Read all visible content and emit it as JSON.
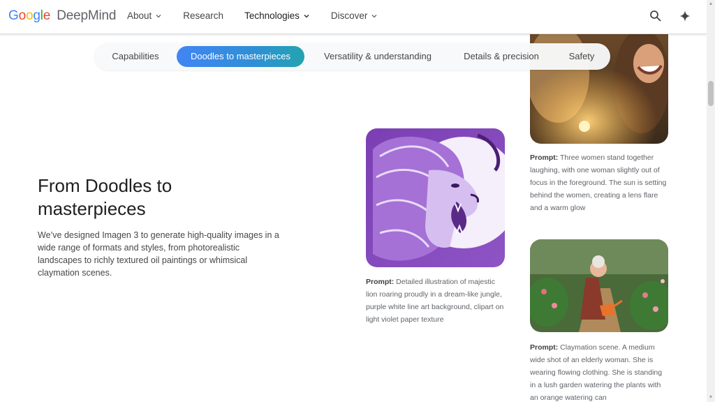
{
  "header": {
    "logo_google": "Google",
    "logo_deepmind": "DeepMind",
    "nav": [
      {
        "label": "About",
        "has_chevron": true
      },
      {
        "label": "Research",
        "has_chevron": false
      },
      {
        "label": "Technologies",
        "has_chevron": true
      },
      {
        "label": "Discover",
        "has_chevron": true
      }
    ],
    "icons": [
      "search-icon",
      "gemini-sparkle-icon"
    ]
  },
  "tabs": [
    {
      "label": "Capabilities"
    },
    {
      "label": "Doodles to masterpieces",
      "active": true
    },
    {
      "label": "Versatility & understanding"
    },
    {
      "label": "Details & precision"
    },
    {
      "label": "Safety"
    }
  ],
  "section": {
    "title": "From Doodles to masterpieces",
    "description": "We’ve designed Imagen 3 to generate high-quality images in a wide range of formats and styles, from photorealistic landscapes to richly textured oil paintings or whimsical claymation scenes."
  },
  "examples": [
    {
      "prompt_label": "Prompt:",
      "prompt": "Detailed illustration of majestic lion roaring proudly in a dream-like jungle, purple white line art background, clipart on light violet paper texture"
    },
    {
      "prompt_label": "Prompt:",
      "prompt": "Three women stand together laughing, with one woman slightly out of focus in the foreground. The sun is setting behind the women, creating a lens flare and a warm glow"
    },
    {
      "prompt_label": "Prompt:",
      "prompt": "Claymation scene. A medium wide shot of an elderly woman. She is wearing flowing clothing. She is standing in a lush garden watering the plants with an orange watering can"
    }
  ],
  "colors": {
    "accent_gradient_start": "#4285f4",
    "accent_gradient_end": "#24a3b0",
    "text_primary": "#1f1f1f",
    "text_secondary": "#5f6368"
  }
}
